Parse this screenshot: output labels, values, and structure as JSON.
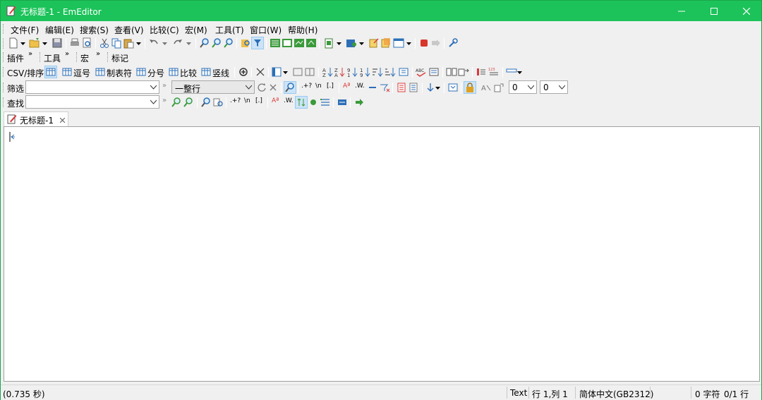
{
  "window": {
    "title": "无标题-1 - EmEditor",
    "accent": "#1cc35a",
    "controls": [
      "minimize-icon",
      "maximize-icon",
      "close-icon"
    ]
  },
  "menu": [
    "文件(F)",
    "编辑(E)",
    "搜索(S)",
    "查看(V)",
    "比较(C)",
    "宏(M)",
    "工具(T)",
    "窗口(W)",
    "帮助(H)"
  ],
  "toolbar2": {
    "plugins": "插件",
    "tools": "工具",
    "macros": "宏",
    "marker": "标记"
  },
  "csvbar": {
    "csv": "CSV/排序",
    "comma": "逗号",
    "tab": "制表符",
    "semicolon": "分号",
    "compare": "比较",
    "pipe": "竖线"
  },
  "filterbar": {
    "label": "筛选",
    "value": "",
    "mode": "一整行",
    "num1": "0",
    "num2": "0"
  },
  "findbar": {
    "label": "查找",
    "value": ""
  },
  "doc_tab": {
    "label": "无标题-1"
  },
  "status": {
    "time": "(0.735 秒)",
    "mode": "Text",
    "position": "行 1,列 1",
    "encoding": "简体中文(GB2312)",
    "chars": "0 字符",
    "lines": "0/1 行"
  }
}
